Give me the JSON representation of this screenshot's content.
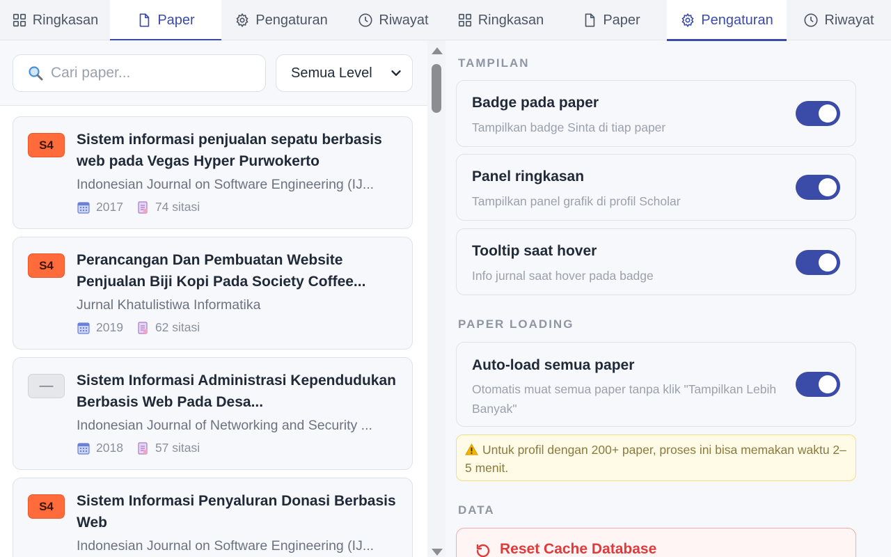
{
  "left_panel": {
    "tabs": [
      {
        "label": "Ringkasan",
        "icon": "grid-icon"
      },
      {
        "label": "Paper",
        "icon": "document-icon"
      },
      {
        "label": "Pengaturan",
        "icon": "gear-icon"
      },
      {
        "label": "Riwayat",
        "icon": "clock-icon"
      }
    ],
    "active_tab": "Paper",
    "search": {
      "placeholder": "Cari paper...",
      "value": ""
    },
    "level_filter": {
      "selected": "Semua Level"
    },
    "papers": [
      {
        "badge": "S4",
        "title": "Sistem informasi penjualan sepatu berbasis web pada Vegas Hyper Purwokerto",
        "journal": "Indonesian Journal on Software Engineering (IJ...",
        "year": "2017",
        "citations": "74 sitasi"
      },
      {
        "badge": "S4",
        "title": "Perancangan Dan Pembuatan Website Penjualan Biji Kopi Pada Society Coffee...",
        "journal": "Jurnal Khatulistiwa Informatika",
        "year": "2019",
        "citations": "62 sitasi"
      },
      {
        "badge": "—",
        "title": "Sistem Informasi Administrasi Kependudukan Berbasis Web Pada Desa...",
        "journal": "Indonesian Journal of Networking and Security ...",
        "year": "2018",
        "citations": "57 sitasi"
      },
      {
        "badge": "S4",
        "title": "Sistem Informasi Penyaluran Donasi Berbasis Web",
        "journal": "Indonesian Journal on Software Engineering (IJ...",
        "year": "",
        "citations": ""
      }
    ]
  },
  "right_panel": {
    "tabs": [
      {
        "label": "Ringkasan",
        "icon": "grid-icon"
      },
      {
        "label": "Paper",
        "icon": "document-icon"
      },
      {
        "label": "Pengaturan",
        "icon": "gear-icon"
      },
      {
        "label": "Riwayat",
        "icon": "clock-icon"
      }
    ],
    "active_tab": "Pengaturan",
    "sections": {
      "tampilan": "TAMPILAN",
      "paper_loading": "PAPER LOADING",
      "data": "DATA"
    },
    "settings": [
      {
        "title": "Badge pada paper",
        "desc": "Tampilkan badge Sinta di tiap paper",
        "enabled": true
      },
      {
        "title": "Panel ringkasan",
        "desc": "Tampilkan panel grafik di profil Scholar",
        "enabled": true
      },
      {
        "title": "Tooltip saat hover",
        "desc": "Info jurnal saat hover pada badge",
        "enabled": true
      },
      {
        "title": "Auto-load semua paper",
        "desc": "Otomatis muat semua paper tanpa klik \"Tampilkan Lebih Banyak\"",
        "enabled": true
      }
    ],
    "warning": "Untuk profil dengan 200+ paper, proses ini bisa memakan waktu 2–5 menit.",
    "reset_button": "Reset Cache Database"
  },
  "colors": {
    "accent": "#3b4ba8",
    "badge_s4": "#ff6b3b",
    "danger": "#e03a3a",
    "warning_bg": "#fffbe6"
  }
}
